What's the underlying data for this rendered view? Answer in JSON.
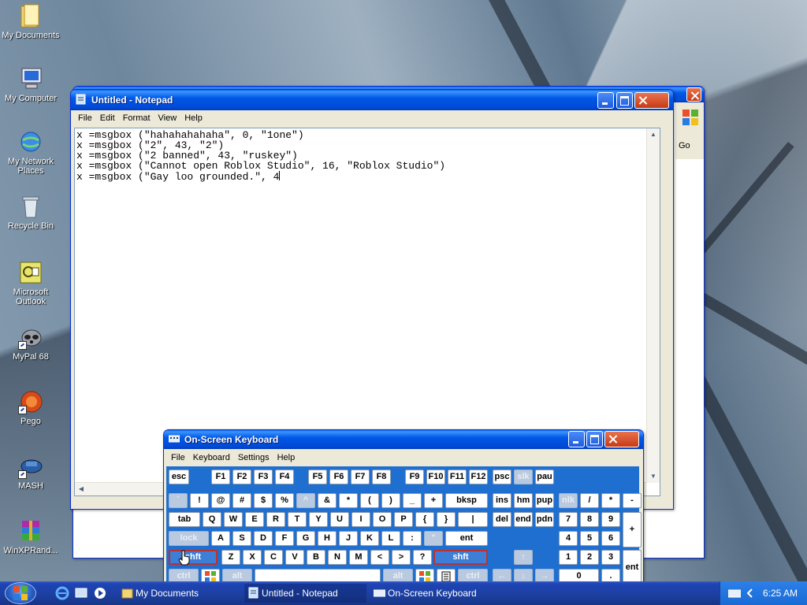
{
  "desktop": {
    "icons": [
      {
        "label": "My Documents"
      },
      {
        "label": "My Computer"
      },
      {
        "label": "My Network Places"
      },
      {
        "label": "Recycle Bin"
      },
      {
        "label": "Microsoft Outlook"
      },
      {
        "label": "MyPal 68"
      },
      {
        "label": "Pego"
      },
      {
        "label": "MASH"
      },
      {
        "label": "WinXPRand..."
      }
    ]
  },
  "bg_window": {
    "go_label": "Go"
  },
  "notepad": {
    "title": "Untitled - Notepad",
    "menu": [
      "File",
      "Edit",
      "Format",
      "View",
      "Help"
    ],
    "text": "x =msgbox (\"hahahahahaha\", 0, \"1one\")\nx =msgbox (\"2\", 43, \"2\")\nx =msgbox (\"2 banned\", 43, \"ruskey\")\nx =msgbox (\"Cannot open Roblox Studio\", 16, \"Roblox Studio\")\nx =msgbox (\"Gay loo grounded.\", 4"
  },
  "osk": {
    "title": "On-Screen Keyboard",
    "menu": [
      "File",
      "Keyboard",
      "Settings",
      "Help"
    ],
    "keys": {
      "esc": "esc",
      "f": [
        "F1",
        "F2",
        "F3",
        "F4",
        "F5",
        "F6",
        "F7",
        "F8",
        "F9",
        "F10",
        "F11",
        "F12"
      ],
      "psc": "psc",
      "slk": "slk",
      "pau": "pau",
      "r1": [
        "`",
        "!",
        "@",
        "#",
        "$",
        "%",
        "^",
        "&",
        "*",
        "(",
        ")",
        "_",
        "+"
      ],
      "bksp": "bksp",
      "ins": "ins",
      "hm": "hm",
      "pup": "pup",
      "nlk": "nlk",
      "slash": "/",
      "star": "*",
      "minus": "-",
      "tab": "tab",
      "r2": [
        "Q",
        "W",
        "E",
        "R",
        "T",
        "Y",
        "U",
        "I",
        "O",
        "P",
        "{",
        "}",
        "|"
      ],
      "del": "del",
      "end": "end",
      "pdn": "pdn",
      "np7": "7",
      "np8": "8",
      "np9": "9",
      "plus": "+",
      "lock": "lock",
      "r3": [
        "A",
        "S",
        "D",
        "F",
        "G",
        "H",
        "J",
        "K",
        "L",
        ":",
        "\""
      ],
      "ent": "ent",
      "np4": "4",
      "np5": "5",
      "np6": "6",
      "shft": "shft",
      "r4": [
        "Z",
        "X",
        "C",
        "V",
        "B",
        "N",
        "M",
        "<",
        ">",
        "?"
      ],
      "np1": "1",
      "np2": "2",
      "np3": "3",
      "npent": "ent",
      "ctrl": "ctrl",
      "alt": "alt",
      "up": "↑",
      "left": "←",
      "down": "↓",
      "right": "→",
      "np0": "0",
      "npdot": "."
    }
  },
  "taskbar": {
    "items": [
      {
        "label": "My Documents"
      },
      {
        "label": "Untitled - Notepad"
      },
      {
        "label": "On-Screen Keyboard"
      }
    ],
    "clock": "6:25 AM"
  }
}
